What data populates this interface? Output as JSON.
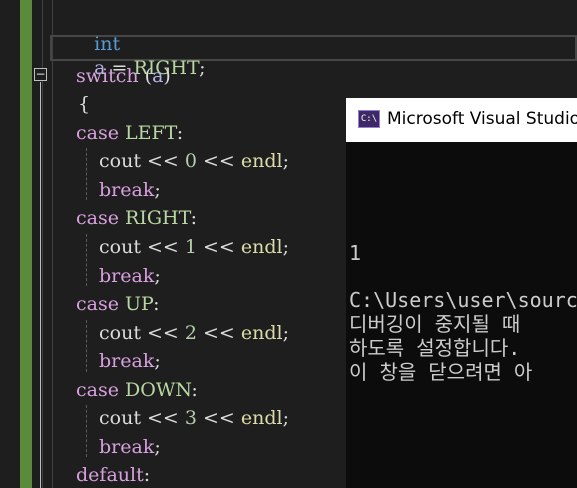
{
  "code": {
    "line_int": {
      "kw": "int",
      "rest_a": "a",
      "eq": " = ",
      "val": "RIGHT",
      "semi": ";"
    },
    "switch_kw": "switch",
    "switch_open": " (",
    "switch_var": "a",
    "switch_close": ")",
    "brace_open": "{",
    "cases": [
      {
        "kw": "case",
        "label": "LEFT",
        "num": "0"
      },
      {
        "kw": "case",
        "label": "RIGHT",
        "num": "1"
      },
      {
        "kw": "case",
        "label": "UP",
        "num": "2"
      },
      {
        "kw": "case",
        "label": "DOWN",
        "num": "3"
      }
    ],
    "colon": ":",
    "cout": "cout",
    "shift": " << ",
    "endl": "endl",
    "semi": ";",
    "break_kw": "break",
    "default_kw": "default"
  },
  "fold": {
    "symbol": "−"
  },
  "console": {
    "title": "Microsoft Visual Studio",
    "icon_text": "C:\\",
    "lines": [
      "1",
      "",
      "C:\\Users\\user\\sourc",
      "디버깅이 중지될 때",
      "하도록 설정합니다.",
      "이 창을 닫으려면 아"
    ]
  }
}
